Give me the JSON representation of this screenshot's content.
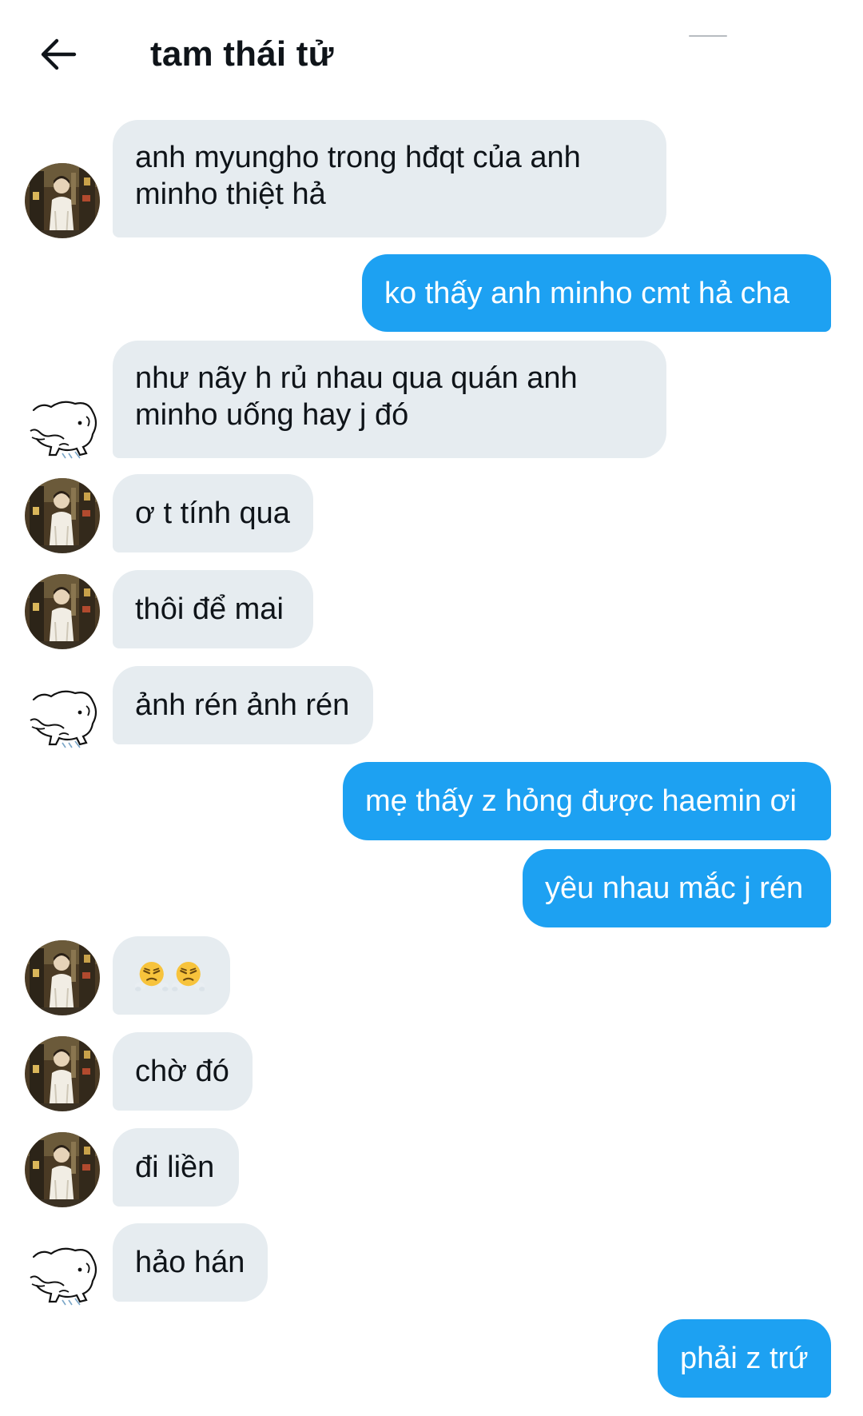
{
  "header": {
    "title": "tam thái tử",
    "back_icon": "arrow-left-icon"
  },
  "colors": {
    "incoming_bubble": "#e6ecf0",
    "outgoing_bubble": "#1da1f2",
    "outgoing_text": "#ffffff",
    "incoming_text": "#0f1419"
  },
  "messages": [
    {
      "direction": "in",
      "avatar": "photo-avatar",
      "text": "anh myungho trong hđqt của anh\nminho thiệt hả"
    },
    {
      "direction": "out",
      "text": "ko thấy anh minho cmt hả cha"
    },
    {
      "direction": "in",
      "avatar": "sketch-avatar",
      "text": "như nãy h rủ nhau qua quán anh\nminho uống hay j đó"
    },
    {
      "direction": "in",
      "avatar": "photo-avatar",
      "text": "ơ t tính qua"
    },
    {
      "direction": "in",
      "avatar": "photo-avatar",
      "text": "thôi để mai"
    },
    {
      "direction": "in",
      "avatar": "sketch-avatar",
      "text": "ảnh rén ảnh rén"
    },
    {
      "direction": "out",
      "text": "mẹ thấy z hỏng được haemin ơi"
    },
    {
      "direction": "out",
      "text": "yêu nhau mắc j rén"
    },
    {
      "direction": "in",
      "avatar": "photo-avatar",
      "text": "😤😤",
      "emoji": "face-with-steam-from-nose-icon"
    },
    {
      "direction": "in",
      "avatar": "photo-avatar",
      "text": "chờ đó"
    },
    {
      "direction": "in",
      "avatar": "photo-avatar",
      "text": "đi liền"
    },
    {
      "direction": "in",
      "avatar": "sketch-avatar",
      "text": "hảo hán"
    },
    {
      "direction": "out",
      "text": "phải z trứ"
    }
  ]
}
